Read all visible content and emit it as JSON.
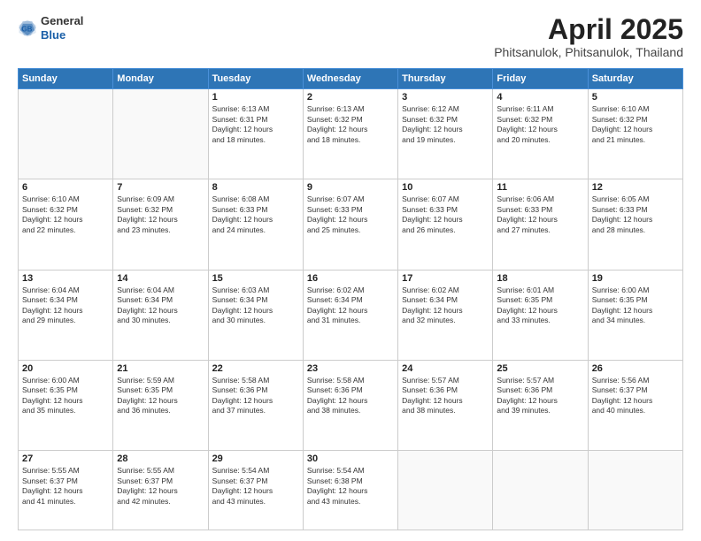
{
  "header": {
    "logo_general": "General",
    "logo_blue": "Blue",
    "title": "April 2025",
    "location": "Phitsanulok, Phitsanulok, Thailand"
  },
  "weekdays": [
    "Sunday",
    "Monday",
    "Tuesday",
    "Wednesday",
    "Thursday",
    "Friday",
    "Saturday"
  ],
  "weeks": [
    [
      {
        "day": "",
        "info": ""
      },
      {
        "day": "",
        "info": ""
      },
      {
        "day": "1",
        "info": "Sunrise: 6:13 AM\nSunset: 6:31 PM\nDaylight: 12 hours\nand 18 minutes."
      },
      {
        "day": "2",
        "info": "Sunrise: 6:13 AM\nSunset: 6:32 PM\nDaylight: 12 hours\nand 18 minutes."
      },
      {
        "day": "3",
        "info": "Sunrise: 6:12 AM\nSunset: 6:32 PM\nDaylight: 12 hours\nand 19 minutes."
      },
      {
        "day": "4",
        "info": "Sunrise: 6:11 AM\nSunset: 6:32 PM\nDaylight: 12 hours\nand 20 minutes."
      },
      {
        "day": "5",
        "info": "Sunrise: 6:10 AM\nSunset: 6:32 PM\nDaylight: 12 hours\nand 21 minutes."
      }
    ],
    [
      {
        "day": "6",
        "info": "Sunrise: 6:10 AM\nSunset: 6:32 PM\nDaylight: 12 hours\nand 22 minutes."
      },
      {
        "day": "7",
        "info": "Sunrise: 6:09 AM\nSunset: 6:32 PM\nDaylight: 12 hours\nand 23 minutes."
      },
      {
        "day": "8",
        "info": "Sunrise: 6:08 AM\nSunset: 6:33 PM\nDaylight: 12 hours\nand 24 minutes."
      },
      {
        "day": "9",
        "info": "Sunrise: 6:07 AM\nSunset: 6:33 PM\nDaylight: 12 hours\nand 25 minutes."
      },
      {
        "day": "10",
        "info": "Sunrise: 6:07 AM\nSunset: 6:33 PM\nDaylight: 12 hours\nand 26 minutes."
      },
      {
        "day": "11",
        "info": "Sunrise: 6:06 AM\nSunset: 6:33 PM\nDaylight: 12 hours\nand 27 minutes."
      },
      {
        "day": "12",
        "info": "Sunrise: 6:05 AM\nSunset: 6:33 PM\nDaylight: 12 hours\nand 28 minutes."
      }
    ],
    [
      {
        "day": "13",
        "info": "Sunrise: 6:04 AM\nSunset: 6:34 PM\nDaylight: 12 hours\nand 29 minutes."
      },
      {
        "day": "14",
        "info": "Sunrise: 6:04 AM\nSunset: 6:34 PM\nDaylight: 12 hours\nand 30 minutes."
      },
      {
        "day": "15",
        "info": "Sunrise: 6:03 AM\nSunset: 6:34 PM\nDaylight: 12 hours\nand 30 minutes."
      },
      {
        "day": "16",
        "info": "Sunrise: 6:02 AM\nSunset: 6:34 PM\nDaylight: 12 hours\nand 31 minutes."
      },
      {
        "day": "17",
        "info": "Sunrise: 6:02 AM\nSunset: 6:34 PM\nDaylight: 12 hours\nand 32 minutes."
      },
      {
        "day": "18",
        "info": "Sunrise: 6:01 AM\nSunset: 6:35 PM\nDaylight: 12 hours\nand 33 minutes."
      },
      {
        "day": "19",
        "info": "Sunrise: 6:00 AM\nSunset: 6:35 PM\nDaylight: 12 hours\nand 34 minutes."
      }
    ],
    [
      {
        "day": "20",
        "info": "Sunrise: 6:00 AM\nSunset: 6:35 PM\nDaylight: 12 hours\nand 35 minutes."
      },
      {
        "day": "21",
        "info": "Sunrise: 5:59 AM\nSunset: 6:35 PM\nDaylight: 12 hours\nand 36 minutes."
      },
      {
        "day": "22",
        "info": "Sunrise: 5:58 AM\nSunset: 6:36 PM\nDaylight: 12 hours\nand 37 minutes."
      },
      {
        "day": "23",
        "info": "Sunrise: 5:58 AM\nSunset: 6:36 PM\nDaylight: 12 hours\nand 38 minutes."
      },
      {
        "day": "24",
        "info": "Sunrise: 5:57 AM\nSunset: 6:36 PM\nDaylight: 12 hours\nand 38 minutes."
      },
      {
        "day": "25",
        "info": "Sunrise: 5:57 AM\nSunset: 6:36 PM\nDaylight: 12 hours\nand 39 minutes."
      },
      {
        "day": "26",
        "info": "Sunrise: 5:56 AM\nSunset: 6:37 PM\nDaylight: 12 hours\nand 40 minutes."
      }
    ],
    [
      {
        "day": "27",
        "info": "Sunrise: 5:55 AM\nSunset: 6:37 PM\nDaylight: 12 hours\nand 41 minutes."
      },
      {
        "day": "28",
        "info": "Sunrise: 5:55 AM\nSunset: 6:37 PM\nDaylight: 12 hours\nand 42 minutes."
      },
      {
        "day": "29",
        "info": "Sunrise: 5:54 AM\nSunset: 6:37 PM\nDaylight: 12 hours\nand 43 minutes."
      },
      {
        "day": "30",
        "info": "Sunrise: 5:54 AM\nSunset: 6:38 PM\nDaylight: 12 hours\nand 43 minutes."
      },
      {
        "day": "",
        "info": ""
      },
      {
        "day": "",
        "info": ""
      },
      {
        "day": "",
        "info": ""
      }
    ]
  ]
}
